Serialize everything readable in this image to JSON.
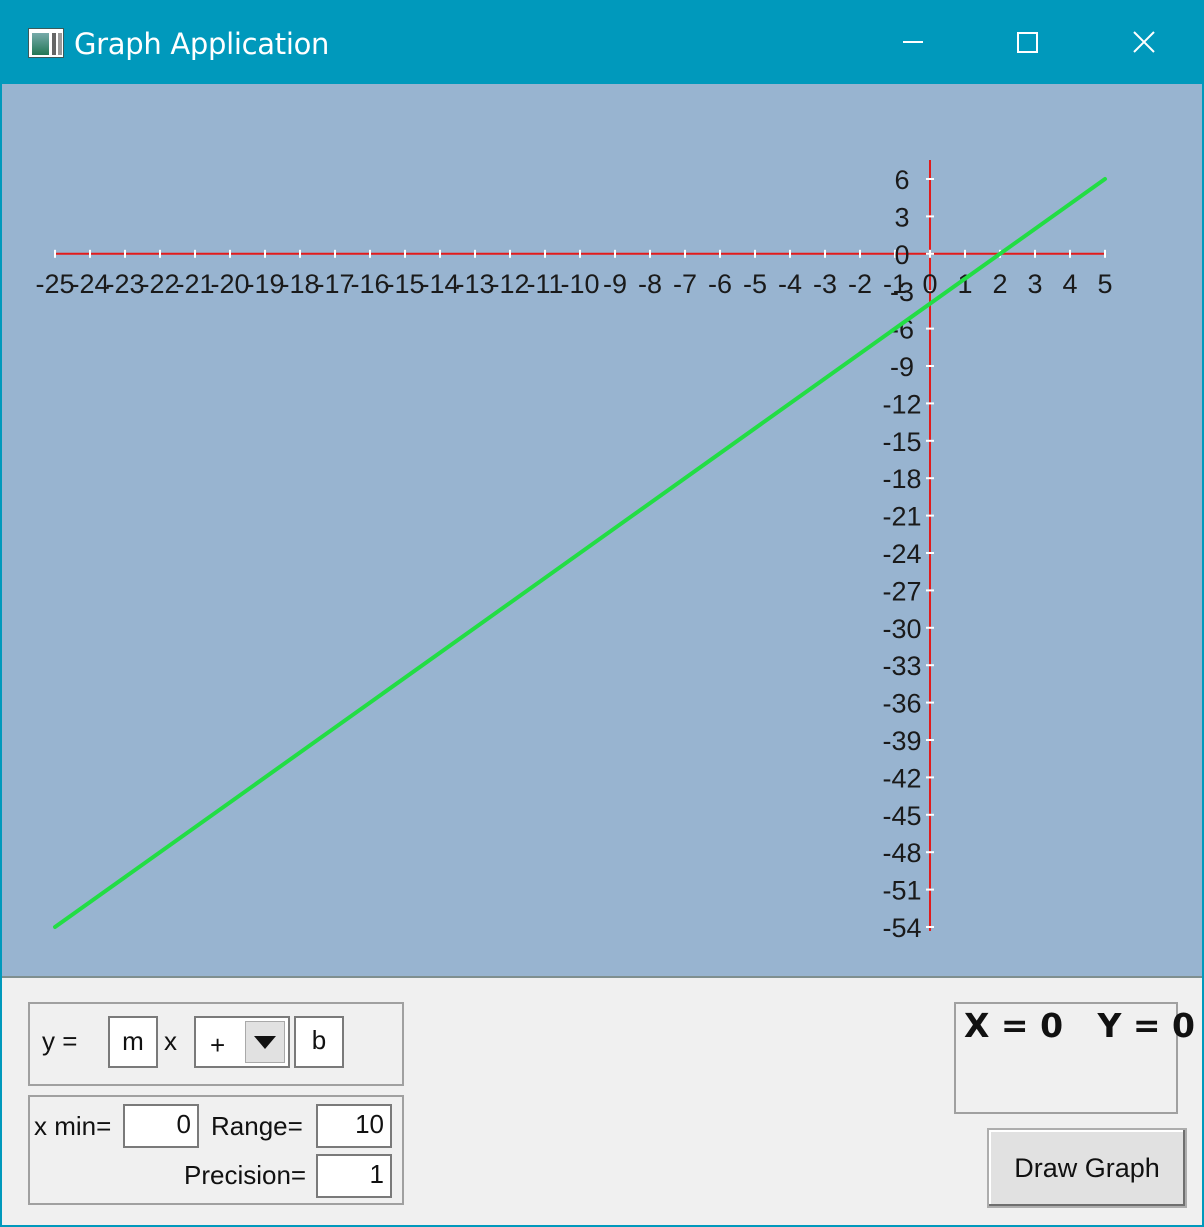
{
  "window": {
    "title": "Graph Application",
    "titlebar_color": "#0099bc"
  },
  "graph": {
    "background": "#98b4d0",
    "axis_color": "#e21b1b",
    "line_color": "#22dd44"
  },
  "chart_data": {
    "type": "line",
    "title": "",
    "xlim": [
      -25,
      5
    ],
    "ylim": [
      -54,
      6
    ],
    "x_ticks": [
      "-25",
      "-24",
      "-23",
      "-22",
      "-21",
      "-20",
      "-19",
      "-18",
      "-17",
      "-16",
      "-15",
      "-14",
      "-13",
      "-12",
      "-11",
      "-10",
      "-9",
      "-8",
      "-7",
      "-6",
      "-5",
      "-4",
      "-3",
      "-2",
      "-1",
      "0",
      "1",
      "2",
      "3",
      "4",
      "5"
    ],
    "y_ticks": [
      "6",
      "3",
      "0",
      "-3",
      "-6",
      "-9",
      "-12",
      "-15",
      "-18",
      "-21",
      "-24",
      "-27",
      "-30",
      "-33",
      "-36",
      "-39",
      "-42",
      "-45",
      "-48",
      "-51",
      "-54"
    ],
    "series": [
      {
        "x": [
          -25,
          5
        ],
        "y": [
          -54,
          6
        ]
      }
    ],
    "grid": false,
    "legend": "none"
  },
  "equation": {
    "y_label": "y =",
    "m_value": "m",
    "x_label": "x",
    "operator": "+",
    "b_value": "b"
  },
  "range": {
    "xmin_label": "x min=",
    "xmin_value": "0",
    "range_label": "Range=",
    "range_value": "10",
    "precision_label": "Precision=",
    "precision_value": "1"
  },
  "coords": {
    "text": "X = 0   Y = 0"
  },
  "buttons": {
    "draw_graph": "Draw Graph"
  },
  "icons": {
    "minimize": "minimize-icon",
    "maximize": "maximize-icon",
    "close": "close-icon",
    "app": "app-window-icon",
    "dropdown": "chevron-down-icon"
  }
}
